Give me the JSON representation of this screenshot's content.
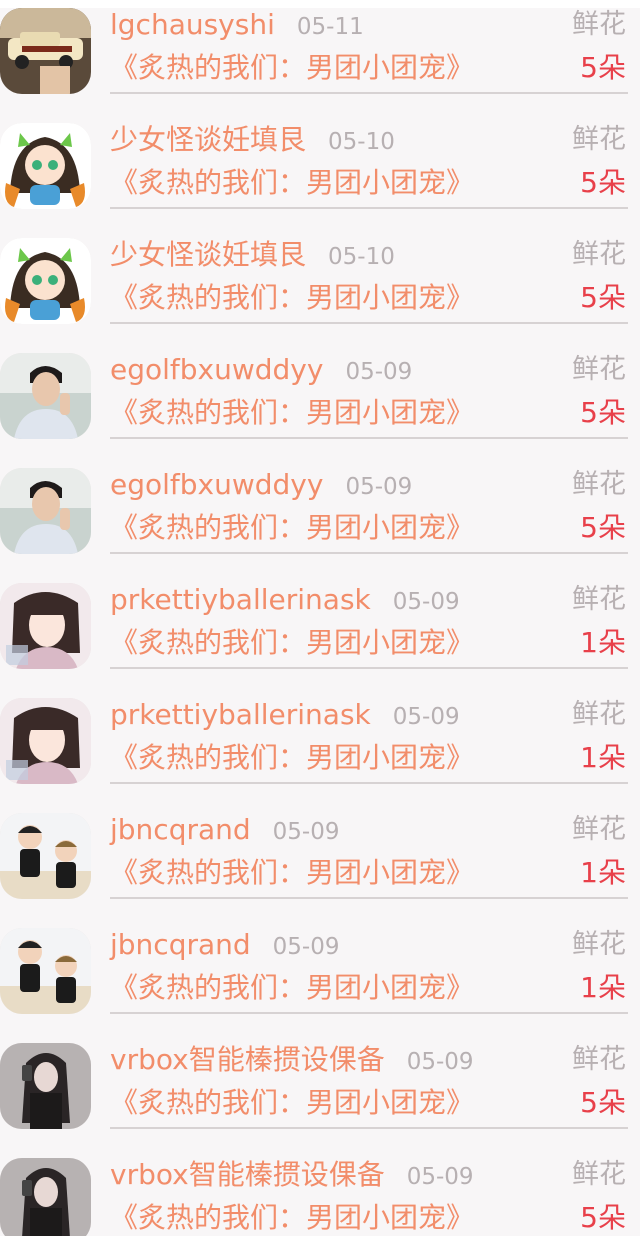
{
  "rows": [
    {
      "username": "lgchausyshi",
      "date": "05-11",
      "gift_type": "鲜花",
      "title": "《炙热的我们：男团小团宠》",
      "count": "5朵",
      "avatar_icon": "car-photo-avatar"
    },
    {
      "username": "少女怪谈妊填艮",
      "date": "05-10",
      "gift_type": "鲜花",
      "title": "《炙热的我们：男团小团宠》",
      "count": "5朵",
      "avatar_icon": "anime-girl-avatar"
    },
    {
      "username": "少女怪谈妊填艮",
      "date": "05-10",
      "gift_type": "鲜花",
      "title": "《炙热的我们：男团小团宠》",
      "count": "5朵",
      "avatar_icon": "anime-girl-avatar"
    },
    {
      "username": "egolfbxuwddyy",
      "date": "05-09",
      "gift_type": "鲜花",
      "title": "《炙热的我们：男团小团宠》",
      "count": "5朵",
      "avatar_icon": "man-portrait-avatar"
    },
    {
      "username": "egolfbxuwddyy",
      "date": "05-09",
      "gift_type": "鲜花",
      "title": "《炙热的我们：男团小团宠》",
      "count": "5朵",
      "avatar_icon": "man-portrait-avatar"
    },
    {
      "username": "prkettiyballerinask",
      "date": "05-09",
      "gift_type": "鲜花",
      "title": "《炙热的我们：男团小团宠》",
      "count": "1朵",
      "avatar_icon": "girl-portrait-avatar"
    },
    {
      "username": "prkettiyballerinask",
      "date": "05-09",
      "gift_type": "鲜花",
      "title": "《炙热的我们：男团小团宠》",
      "count": "1朵",
      "avatar_icon": "girl-portrait-avatar"
    },
    {
      "username": "jbncqrand",
      "date": "05-09",
      "gift_type": "鲜花",
      "title": "《炙热的我们：男团小团宠》",
      "count": "1朵",
      "avatar_icon": "cartoon-duo-avatar"
    },
    {
      "username": "jbncqrand",
      "date": "05-09",
      "gift_type": "鲜花",
      "title": "《炙热的我们：男团小团宠》",
      "count": "1朵",
      "avatar_icon": "cartoon-duo-avatar"
    },
    {
      "username": "vrbox智能榛掼设倮备",
      "date": "05-09",
      "gift_type": "鲜花",
      "title": "《炙热的我们：男团小团宠》",
      "count": "5朵",
      "avatar_icon": "woman-selfie-avatar"
    },
    {
      "username": "vrbox智能榛掼设倮备",
      "date": "05-09",
      "gift_type": "鲜花",
      "title": "《炙热的我们：男团小团宠》",
      "count": "5朵",
      "avatar_icon": "woman-selfie-avatar"
    }
  ]
}
